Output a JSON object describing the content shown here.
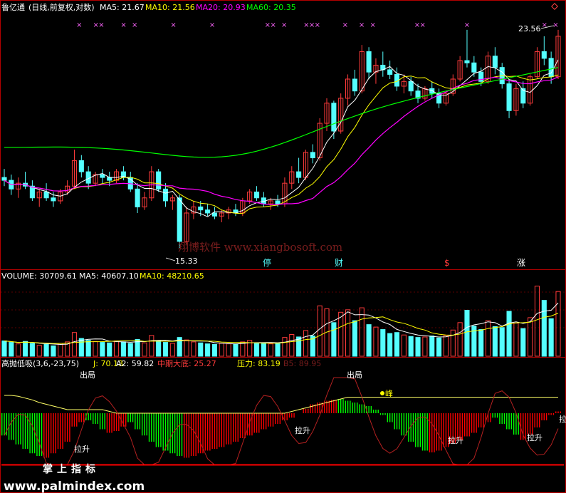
{
  "colors": {
    "background": "#000000",
    "up": "#ff3b3b",
    "down": "#54ffff",
    "ma5": "#ffffff",
    "ma10": "#ffff00",
    "ma20": "#ff00ff",
    "ma60": "#00ff00",
    "panel_border": "#b40000",
    "green_bar": "#00ff00",
    "red_bar": "#ff0000",
    "watermark": "#7a1d1d"
  },
  "icon": "diamond-icon",
  "main_panel": {
    "stock": "鲁亿通",
    "mode": "(日线,前复权,对数)",
    "ma5": "MA5: 21.67",
    "ma10": "MA10: 21.56",
    "ma20": "MA20: 20.93",
    "ma60": "MA60: 20.35",
    "high_label": "23.56",
    "low_label": "15.33",
    "markers": [
      "停",
      "财",
      "$",
      "涨"
    ],
    "watermark": "翔博软件 www.xiangbosoft.com"
  },
  "volume_panel": {
    "title": "VOLUME: 30709.61",
    "ma5": "MA5: 40607.10",
    "ma10": "MA10: 48210.65"
  },
  "indicator_panel": {
    "title": "高抛低吸(3,6,-23,75)",
    "j": "J: 70.13",
    "a2": "A2: 59.82",
    "mid_bottom": "中期大底: 25.27",
    "pressure": "压力: 83.19",
    "b5": "B5: 89.95",
    "labels_out": [
      "出局",
      "出局"
    ],
    "labels_up": [
      "拉升",
      "拉升",
      "拉升",
      "拉升",
      "拉升"
    ],
    "label_peak": "峰",
    "bottom_text": "掌上指标",
    "footer": "www.palmindex.com"
  },
  "chart_data": {
    "type": "candlestick",
    "price": {
      "ohlc": [
        [
          17.6,
          17.9,
          17.3,
          17.5
        ],
        [
          17.5,
          17.7,
          17.0,
          17.2
        ],
        [
          17.2,
          17.6,
          16.9,
          17.4
        ],
        [
          17.4,
          17.8,
          17.2,
          17.3
        ],
        [
          17.3,
          17.5,
          16.8,
          16.9
        ],
        [
          16.9,
          17.2,
          16.6,
          17.1
        ],
        [
          17.1,
          17.4,
          16.8,
          16.9
        ],
        [
          16.9,
          17.1,
          16.6,
          16.8
        ],
        [
          16.8,
          17.2,
          16.7,
          17.1
        ],
        [
          17.1,
          17.5,
          17.0,
          17.3
        ],
        [
          17.3,
          18.6,
          17.2,
          18.2
        ],
        [
          18.2,
          18.4,
          17.6,
          17.8
        ],
        [
          17.8,
          18.0,
          17.2,
          17.4
        ],
        [
          17.4,
          17.8,
          17.3,
          17.7
        ],
        [
          17.7,
          17.9,
          17.4,
          17.6
        ],
        [
          17.6,
          17.8,
          17.3,
          17.5
        ],
        [
          17.5,
          17.9,
          17.4,
          17.8
        ],
        [
          17.8,
          18.0,
          17.5,
          17.6
        ],
        [
          17.6,
          17.8,
          17.1,
          17.2
        ],
        [
          17.2,
          17.4,
          16.4,
          16.6
        ],
        [
          16.6,
          17.1,
          16.5,
          16.9
        ],
        [
          16.9,
          18.0,
          16.8,
          17.8
        ],
        [
          17.8,
          17.9,
          17.1,
          17.2
        ],
        [
          17.2,
          17.4,
          16.6,
          16.8
        ],
        [
          16.8,
          17.0,
          16.5,
          16.9
        ],
        [
          16.9,
          17.0,
          15.3,
          15.5
        ],
        [
          15.5,
          16.6,
          15.4,
          16.4
        ],
        [
          16.4,
          16.8,
          16.2,
          16.6
        ],
        [
          16.6,
          16.8,
          16.3,
          16.5
        ],
        [
          16.5,
          16.7,
          16.3,
          16.4
        ],
        [
          16.4,
          16.6,
          16.2,
          16.3
        ],
        [
          16.3,
          16.5,
          16.1,
          16.4
        ],
        [
          16.4,
          16.6,
          16.2,
          16.5
        ],
        [
          16.5,
          16.7,
          16.3,
          16.4
        ],
        [
          16.4,
          16.9,
          16.3,
          16.8
        ],
        [
          16.8,
          17.2,
          16.7,
          17.1
        ],
        [
          17.1,
          17.3,
          16.8,
          16.9
        ],
        [
          16.9,
          17.1,
          16.6,
          16.7
        ],
        [
          16.7,
          16.9,
          16.5,
          16.8
        ],
        [
          16.8,
          17.0,
          16.6,
          16.7
        ],
        [
          16.7,
          17.6,
          16.6,
          17.4
        ],
        [
          17.4,
          18.0,
          17.2,
          17.8
        ],
        [
          17.8,
          18.3,
          17.4,
          17.6
        ],
        [
          17.6,
          18.6,
          17.5,
          18.5
        ],
        [
          18.5,
          18.8,
          18.1,
          18.3
        ],
        [
          18.3,
          19.8,
          18.2,
          19.6
        ],
        [
          19.6,
          20.6,
          19.3,
          20.4
        ],
        [
          20.4,
          20.5,
          19.0,
          19.3
        ],
        [
          19.3,
          20.8,
          19.2,
          20.6
        ],
        [
          20.6,
          21.6,
          20.3,
          21.4
        ],
        [
          21.4,
          21.8,
          20.7,
          20.9
        ],
        [
          20.9,
          22.9,
          20.8,
          22.6
        ],
        [
          22.6,
          22.8,
          21.4,
          21.7
        ],
        [
          21.7,
          22.3,
          21.2,
          22.0
        ],
        [
          22.0,
          22.6,
          21.5,
          21.8
        ],
        [
          21.8,
          22.2,
          21.4,
          21.6
        ],
        [
          21.6,
          21.9,
          20.9,
          21.1
        ],
        [
          21.1,
          21.6,
          20.8,
          21.3
        ],
        [
          21.3,
          21.5,
          20.7,
          20.9
        ],
        [
          20.9,
          21.2,
          20.4,
          20.6
        ],
        [
          20.6,
          21.1,
          20.5,
          21.0
        ],
        [
          21.0,
          21.3,
          20.6,
          20.8
        ],
        [
          20.8,
          21.0,
          20.2,
          20.4
        ],
        [
          20.4,
          20.9,
          20.3,
          20.8
        ],
        [
          20.8,
          21.6,
          20.7,
          21.4
        ],
        [
          21.4,
          22.4,
          21.3,
          22.2
        ],
        [
          22.2,
          23.6,
          21.9,
          22.1
        ],
        [
          22.1,
          22.4,
          21.5,
          21.7
        ],
        [
          21.7,
          21.9,
          21.1,
          21.3
        ],
        [
          21.3,
          22.6,
          21.2,
          22.4
        ],
        [
          22.4,
          22.8,
          21.6,
          21.9
        ],
        [
          21.9,
          22.1,
          21.0,
          21.2
        ],
        [
          21.2,
          21.4,
          19.8,
          20.1
        ],
        [
          20.1,
          21.2,
          19.9,
          21.0
        ],
        [
          21.0,
          21.3,
          20.2,
          20.4
        ],
        [
          20.4,
          21.6,
          20.3,
          21.5
        ],
        [
          21.5,
          22.8,
          21.4,
          22.6
        ],
        [
          22.6,
          23.3,
          22.0,
          22.3
        ],
        [
          22.3,
          22.6,
          21.2,
          21.5
        ],
        [
          21.5,
          23.6,
          21.4,
          23.3
        ]
      ],
      "high_value": 23.56,
      "low_value": 15.33,
      "ma60_range": [
        18.4,
        21.6
      ]
    },
    "volume": {
      "values": [
        3.1,
        2.8,
        2.5,
        3.0,
        2.6,
        2.2,
        2.4,
        2.1,
        2.6,
        2.9,
        4.8,
        3.6,
        3.2,
        3.0,
        2.8,
        2.7,
        3.1,
        2.9,
        2.6,
        3.4,
        2.7,
        4.2,
        3.1,
        2.8,
        2.6,
        3.8,
        3.3,
        2.9,
        2.7,
        2.5,
        2.4,
        2.6,
        2.5,
        2.4,
        2.9,
        3.2,
        2.7,
        2.6,
        2.5,
        2.6,
        3.8,
        4.4,
        3.9,
        5.2,
        4.1,
        10.2,
        9.6,
        6.8,
        8.9,
        9.4,
        7.2,
        9.8,
        6.4,
        5.9,
        5.4,
        4.6,
        4.8,
        4.3,
        4.0,
        3.8,
        3.9,
        4.1,
        3.7,
        4.2,
        5.3,
        6.8,
        9.3,
        6.1,
        5.4,
        7.2,
        6.0,
        5.8,
        9.1,
        6.7,
        5.6,
        7.8,
        14.2,
        11.3,
        7.6,
        13.1
      ],
      "scale_max": 15
    },
    "indicator": {
      "histogram": [
        35,
        30,
        25,
        20,
        15,
        12,
        10,
        15,
        20,
        28,
        45,
        50,
        52,
        48,
        42,
        38,
        40,
        45,
        50,
        42,
        35,
        28,
        22,
        18,
        15,
        12,
        10,
        12,
        15,
        18,
        20,
        22,
        25,
        28,
        32,
        35,
        38,
        42,
        45,
        48,
        52,
        55,
        60,
        65,
        70,
        72,
        74,
        75,
        76,
        74,
        72,
        70,
        68,
        64,
        58,
        50,
        42,
        35,
        28,
        22,
        18,
        16,
        18,
        22,
        26,
        30,
        34,
        38,
        44,
        50,
        55,
        48,
        42,
        36,
        30,
        36,
        44,
        52,
        58,
        62
      ],
      "pressure_line": [
        80,
        80,
        79,
        77,
        75,
        72,
        70,
        68,
        66,
        64,
        64,
        64,
        64,
        64,
        64,
        62,
        60,
        60,
        60,
        60,
        60,
        60,
        60,
        60,
        60,
        60,
        60,
        60,
        60,
        60,
        60,
        60,
        60,
        60,
        60,
        60,
        60,
        60,
        60,
        60,
        60,
        62,
        64,
        66,
        68,
        70,
        72,
        74,
        76,
        78,
        78,
        78,
        78,
        78,
        78,
        78,
        78,
        78,
        78,
        78,
        78,
        78,
        78,
        78,
        78,
        78,
        78,
        78,
        78,
        78,
        78,
        78,
        78,
        78,
        78,
        78,
        78,
        78,
        78,
        78
      ],
      "scale": [
        0,
        100
      ]
    }
  }
}
